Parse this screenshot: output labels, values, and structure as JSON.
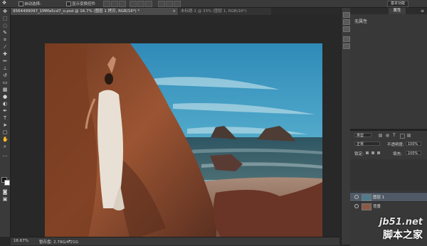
{
  "options_bar": {
    "auto_select_label": "自动选择:",
    "transform_controls_label": "显示变换控件",
    "workspace_button": "基本功能"
  },
  "document": {
    "tab_title": "9564499097_1MMa5cd7_o.psd @ 16.7% (图层 1 拷贝, RGB/16*) *",
    "tab_title_2": "未标题-1 @ 33% (图层 1, RGB/16*)",
    "close_glyph": "×"
  },
  "status_bar": {
    "zoom": "16.67%",
    "doc_info": "暂存盘: 2.79G/4.21G"
  },
  "properties_panel": {
    "tab_label": "属性",
    "body_label": "无属性"
  },
  "layers_panel": {
    "kind_label": "类型",
    "blend_mode": "正常",
    "opacity_label": "不透明度:",
    "opacity_value": "100%",
    "lock_label": "锁定:",
    "fill_label": "填充:",
    "fill_value": "100%",
    "layers": [
      {
        "name": "图层 1"
      },
      {
        "name": "背景"
      }
    ]
  },
  "watermark": {
    "url_text": "jb51.net",
    "site_name": "脚本之家"
  },
  "colors": {
    "ui_dark": "#282828",
    "panel": "#3a3a3a",
    "sky": "#3f9cc4",
    "sea": "#2f5a68",
    "rock": "#8a4a2c"
  }
}
